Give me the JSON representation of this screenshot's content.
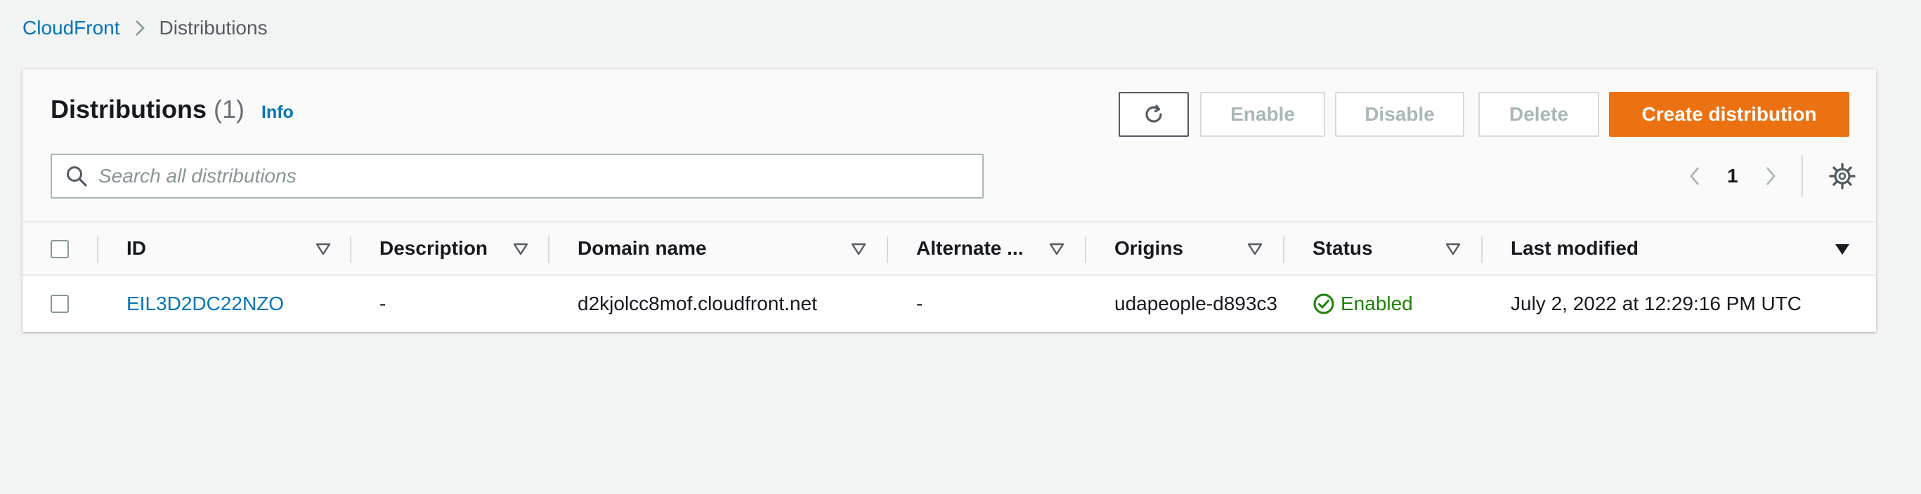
{
  "breadcrumb": {
    "root": "CloudFront",
    "current": "Distributions"
  },
  "header": {
    "title": "Distributions",
    "count": "(1)",
    "info": "Info"
  },
  "toolbar": {
    "refresh_icon": "refresh-icon",
    "enable": "Enable",
    "disable": "Disable",
    "delete": "Delete",
    "create": "Create distribution"
  },
  "search": {
    "placeholder": "Search all distributions",
    "value": ""
  },
  "pagination": {
    "page": "1"
  },
  "table": {
    "columns": {
      "id": "ID",
      "description": "Description",
      "domain": "Domain name",
      "alternate": "Alternate ...",
      "origins": "Origins",
      "status": "Status",
      "last_modified": "Last modified"
    },
    "rows": [
      {
        "id": "EIL3D2DC22NZO",
        "description": "-",
        "domain": "d2kjolcc8mof.cloudfront.net",
        "alternate": "-",
        "origins": "udapeople-d893c3",
        "status": "Enabled",
        "last_modified": "July 2, 2022 at 12:29:16 PM UTC"
      }
    ]
  },
  "colors": {
    "link": "#0073bb",
    "primary": "#ec7211",
    "success": "#1d8102",
    "disabled": "#aab7b8"
  }
}
